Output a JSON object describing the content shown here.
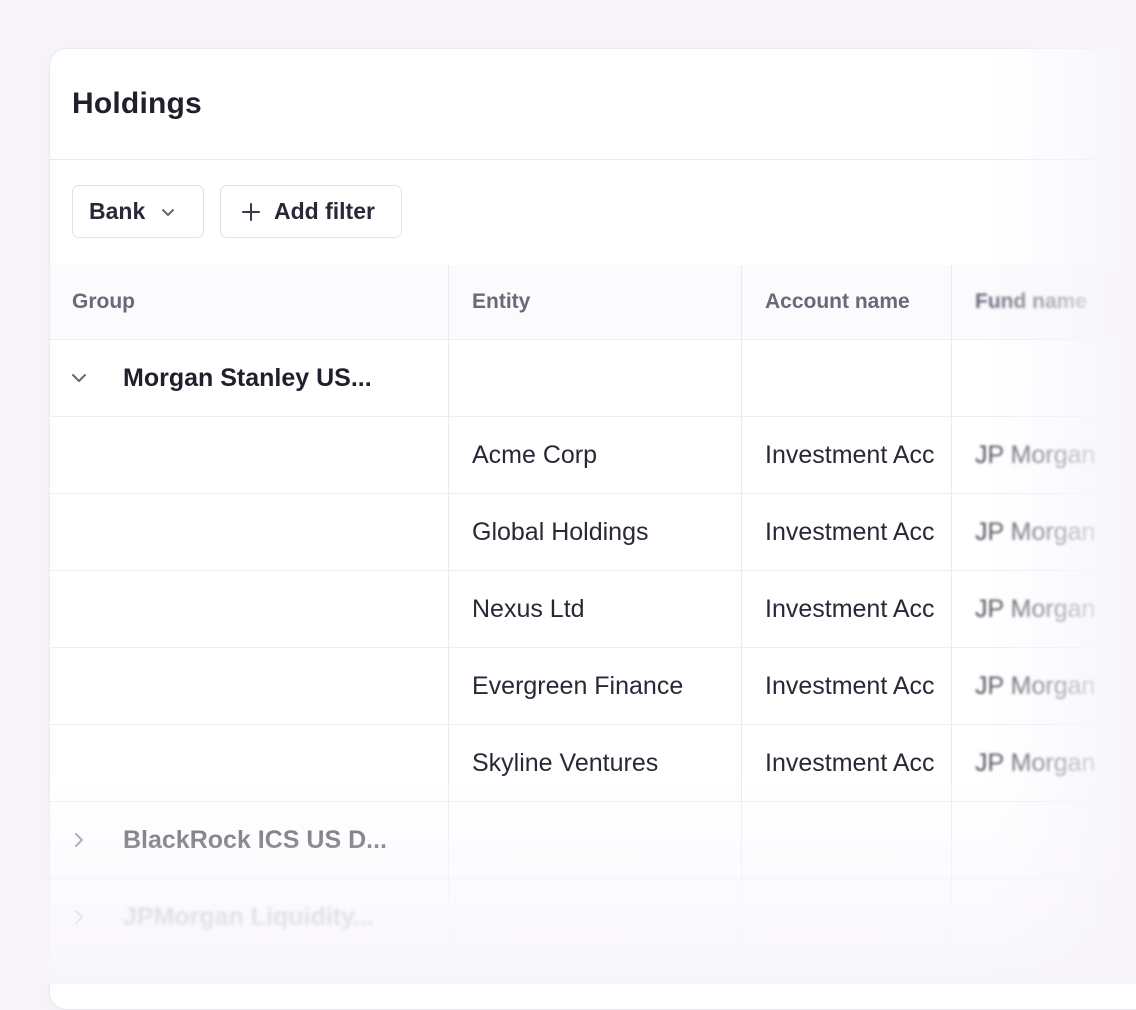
{
  "page": {
    "title": "Holdings"
  },
  "filters": {
    "bank_label": "Bank",
    "bank_icon": "chevron-down-icon",
    "add_filter_label": "Add filter",
    "add_filter_icon": "plus-icon"
  },
  "table": {
    "columns": [
      "Group",
      "Entity",
      "Account name",
      "Fund name"
    ],
    "groups": [
      {
        "name": "Morgan Stanley US...",
        "expanded": true,
        "icon": "chevron-down-icon",
        "rows": [
          {
            "entity": "Acme Corp",
            "account": "Investment Acc",
            "fund": "JP Morgan"
          },
          {
            "entity": "Global Holdings",
            "account": "Investment Acc",
            "fund": "JP Morgan"
          },
          {
            "entity": "Nexus Ltd",
            "account": "Investment Acc",
            "fund": "JP Morgan"
          },
          {
            "entity": "Evergreen Finance",
            "account": "Investment Acc",
            "fund": "JP Morgan"
          },
          {
            "entity": "Skyline Ventures",
            "account": "Investment Acc",
            "fund": "JP Morgan"
          }
        ]
      },
      {
        "name": "BlackRock ICS US D...",
        "expanded": false,
        "icon": "chevron-right-icon"
      },
      {
        "name": "JPMorgan Liquidity...",
        "expanded": false,
        "icon": "chevron-right-icon"
      }
    ]
  },
  "colors": {
    "background": "#f8f6fb",
    "card": "#ffffff",
    "border": "#ebe9f0",
    "text_primary": "#211f2c",
    "text_header": "#6b6878"
  }
}
